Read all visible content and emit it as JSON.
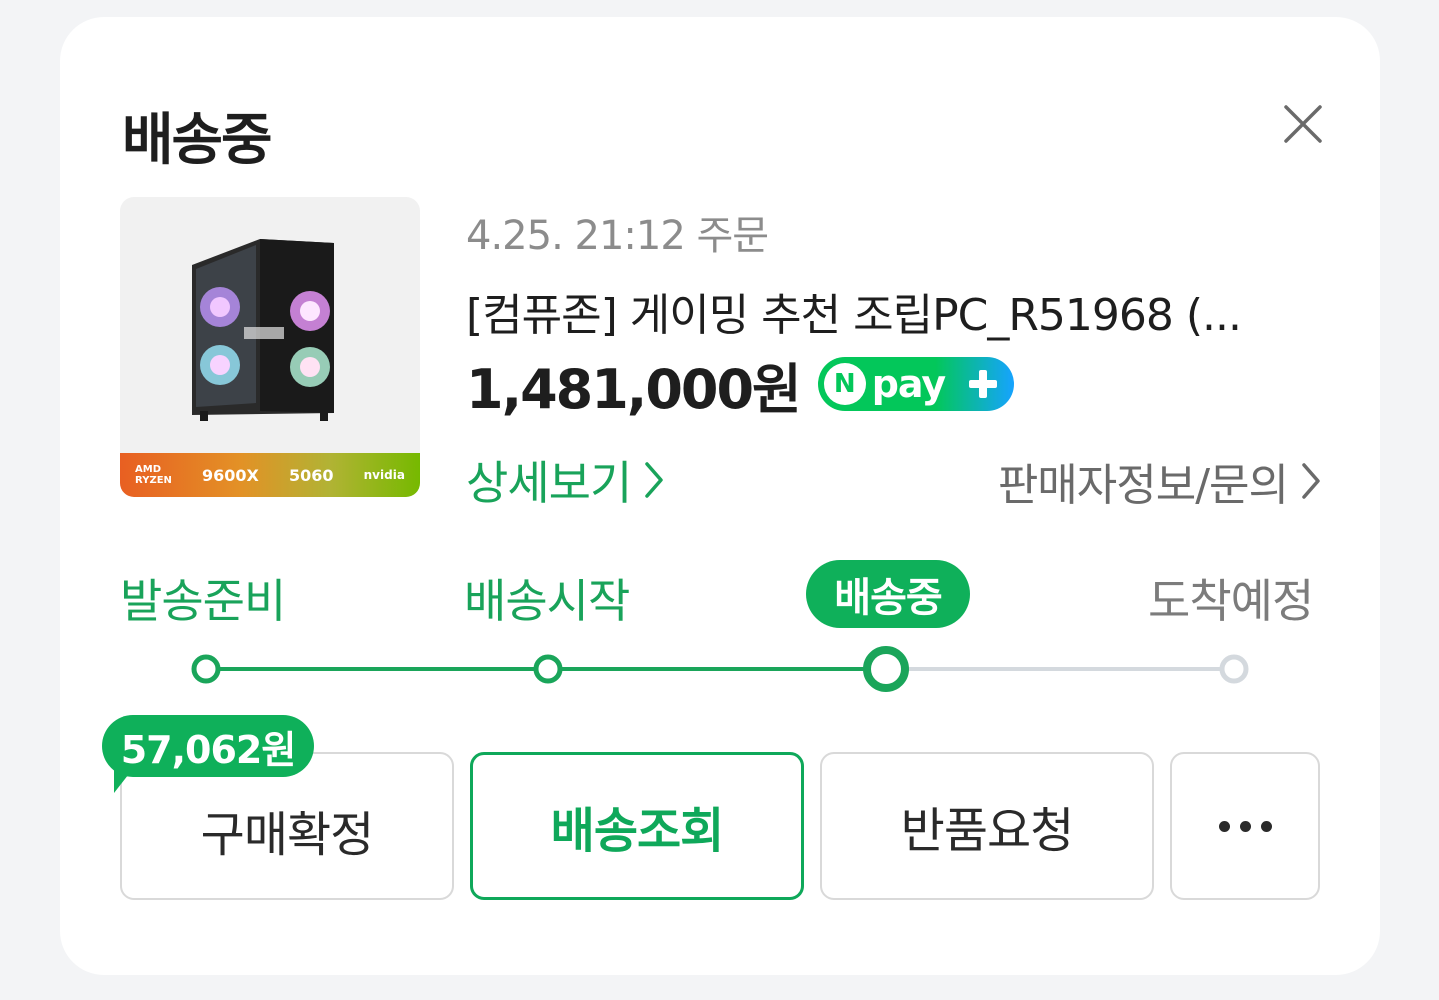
{
  "header": {
    "title": "배송중"
  },
  "order": {
    "date_text": "4.25. 21:12 주문",
    "product_name": "[컴퓨존] 게이밍 추천 조립PC_R51968 (...",
    "price": "1,481,000원",
    "payment_badge": {
      "n": "N",
      "label": "pay"
    },
    "thumbnail_band": {
      "brand": "AMD\nRYZEN",
      "cpu": "9600X",
      "gpu": "5060",
      "gpu_brand": "nvidia"
    },
    "detail_link": "상세보기",
    "seller_link": "판매자정보/문의"
  },
  "progress": {
    "steps": [
      {
        "label": "발송준비",
        "state": "done"
      },
      {
        "label": "배송시작",
        "state": "done"
      },
      {
        "label": "배송중",
        "state": "active"
      },
      {
        "label": "도착예정",
        "state": "pending"
      }
    ]
  },
  "actions": {
    "reward_bubble": "57,062원",
    "confirm": "구매확정",
    "track": "배송조회",
    "return": "반품요청",
    "more_icon": "more-horizontal-icon"
  },
  "colors": {
    "accent_green": "#0fb05a",
    "text_green": "#19a35a",
    "pending_gray": "#d4d9de"
  }
}
